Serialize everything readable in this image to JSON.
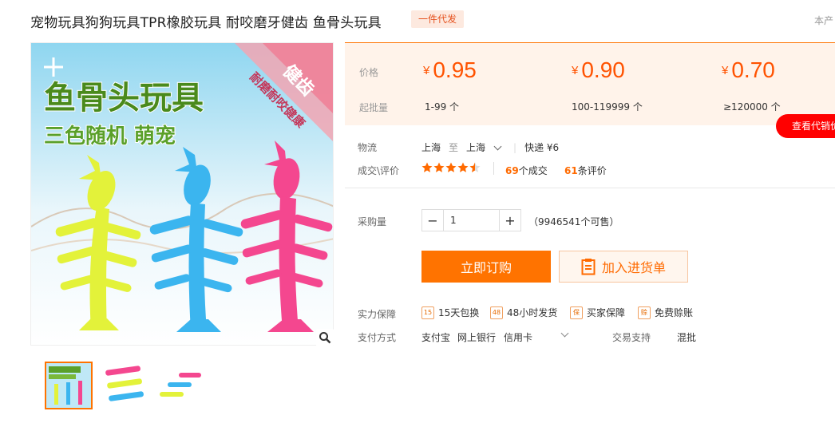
{
  "header": {
    "title": "宠物玩具狗狗玩具TPR橡胶玩具 耐咬磨牙健齿 鱼骨头玩具",
    "badge": "一件代发",
    "right_hint": "本产"
  },
  "gallery": {
    "main_banner_line1": "鱼骨头玩具",
    "main_banner_line2": "三色随机 萌宠",
    "corner_text1": "健齿",
    "corner_text2": "耐磨耐咬健康",
    "fish_colors": [
      "#e3f23a",
      "#3bb5ef",
      "#f4478f"
    ],
    "thumb_count": 3
  },
  "price": {
    "price_label": "价格",
    "moq_label": "起批量",
    "tiers": [
      {
        "currency": "¥",
        "price": "0.95",
        "range": "1-99 个"
      },
      {
        "currency": "¥",
        "price": "0.90",
        "range": "100-119999 个"
      },
      {
        "currency": "¥",
        "price": "0.70",
        "range": "≥120000 个"
      }
    ],
    "agent_button": "查看代销价"
  },
  "logistics": {
    "label": "物流",
    "from": "上海",
    "to_word": "至",
    "to": "上海",
    "shipping": "快递 ¥6"
  },
  "reviews": {
    "label": "成交\\评价",
    "rating": 4.5,
    "deals_count": "69",
    "deals_suffix": "个成交",
    "review_count": "61",
    "review_suffix": "条评价"
  },
  "purchase": {
    "label": "采购量",
    "quantity": "1",
    "stock": "（9946541个可售）",
    "buy_now": "立即订购",
    "add_cart": "加入进货单"
  },
  "guarantee": {
    "label": "实力保障",
    "items": [
      {
        "icon": "15-day-return-icon",
        "glyph": "15",
        "text": "15天包换"
      },
      {
        "icon": "48h-ship-icon",
        "glyph": "48",
        "text": "48小时发货"
      },
      {
        "icon": "buyer-protection-icon",
        "glyph": "保",
        "text": "买家保障"
      },
      {
        "icon": "free-credit-icon",
        "glyph": "赊",
        "text": "免费赊账"
      }
    ]
  },
  "payment": {
    "label": "支付方式",
    "methods": [
      "支付宝",
      "网上银行",
      "信用卡"
    ],
    "trade_label": "交易支持",
    "trade_value": "混批"
  },
  "colors": {
    "accent": "#ff7300",
    "price": "#ff5200",
    "panel_bg": "#fff3ea",
    "red_button": "#ff0000"
  }
}
